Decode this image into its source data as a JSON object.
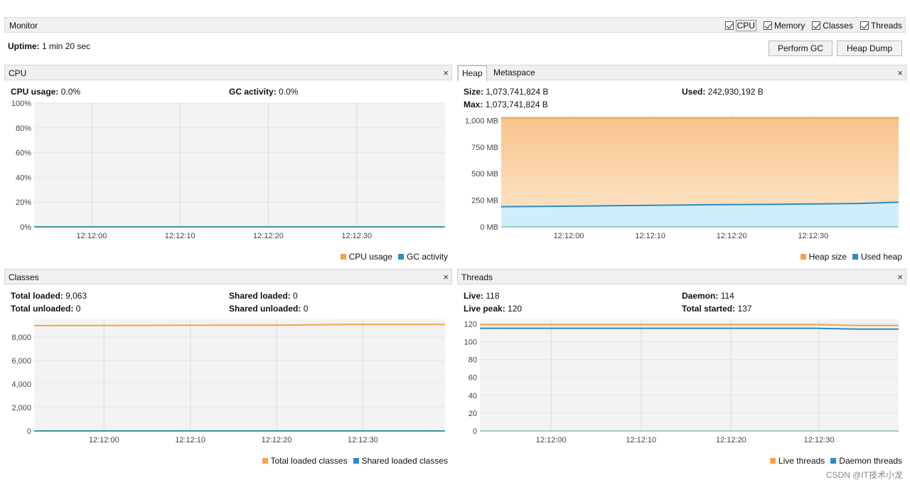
{
  "monitor": {
    "title": "Monitor",
    "checks": [
      {
        "label": "CPU"
      },
      {
        "label": "Memory"
      },
      {
        "label": "Classes"
      },
      {
        "label": "Threads"
      }
    ]
  },
  "uptime": {
    "label": "Uptime:",
    "value": "1 min 20 sec"
  },
  "buttons": {
    "perform_gc": "Perform GC",
    "heap_dump": "Heap Dump"
  },
  "cpu": {
    "title": "CPU",
    "close": "×",
    "usage_label": "CPU usage:",
    "usage_value": "0.0%",
    "gc_label": "GC activity:",
    "gc_value": "0.0%",
    "legend": [
      {
        "name": "CPU usage",
        "color": "#f0a54a"
      },
      {
        "name": "GC activity",
        "color": "#2e8bc0"
      }
    ]
  },
  "heap": {
    "tabs": [
      "Heap",
      "Metaspace"
    ],
    "close": "×",
    "size_label": "Size:",
    "size_value": "1,073,741,824 B",
    "used_label": "Used:",
    "used_value": "242,930,192 B",
    "max_label": "Max:",
    "max_value": "1,073,741,824 B",
    "legend": [
      {
        "name": "Heap size",
        "color": "#f0a54a"
      },
      {
        "name": "Used heap",
        "color": "#2e8bc0"
      }
    ]
  },
  "classes": {
    "title": "Classes",
    "close": "×",
    "total_loaded_label": "Total loaded:",
    "total_loaded_value": "9,063",
    "total_unloaded_label": "Total unloaded:",
    "total_unloaded_value": "0",
    "shared_loaded_label": "Shared loaded:",
    "shared_loaded_value": "0",
    "shared_unloaded_label": "Shared unloaded:",
    "shared_unloaded_value": "0",
    "legend": [
      {
        "name": "Total loaded classes",
        "color": "#f0a54a"
      },
      {
        "name": "Shared loaded classes",
        "color": "#2e8bc0"
      }
    ]
  },
  "threads": {
    "title": "Threads",
    "close": "×",
    "live_label": "Live:",
    "live_value": "118",
    "daemon_label": "Daemon:",
    "daemon_value": "114",
    "peak_label": "Live peak:",
    "peak_value": "120",
    "started_label": "Total started:",
    "started_value": "137",
    "legend": [
      {
        "name": "Live threads",
        "color": "#f0a54a"
      },
      {
        "name": "Daemon threads",
        "color": "#2e8bc0"
      }
    ]
  },
  "watermark": "CSDN @IT技术小龙",
  "chart_data": [
    {
      "id": "cpu",
      "type": "line",
      "x_ticks": [
        "12:12:00",
        "12:12:10",
        "12:12:20",
        "12:12:30"
      ],
      "y_ticks": [
        "0%",
        "20%",
        "40%",
        "60%",
        "80%",
        "100%"
      ],
      "ylim": [
        0,
        100
      ],
      "series": [
        {
          "name": "CPU usage",
          "color": "#f0a54a",
          "values": [
            0,
            0,
            0,
            0,
            0,
            0,
            0,
            0,
            0
          ]
        },
        {
          "name": "GC activity",
          "color": "#2e8bc0",
          "values": [
            0,
            0,
            0,
            0,
            0,
            0,
            0,
            0,
            0
          ]
        }
      ]
    },
    {
      "id": "heap",
      "type": "area",
      "x_ticks": [
        "12:12:00",
        "12:12:10",
        "12:12:20",
        "12:12:30"
      ],
      "y_ticks": [
        "0 MB",
        "250 MB",
        "500 MB",
        "750 MB",
        "1,000 MB"
      ],
      "ylim": [
        0,
        1050
      ],
      "series": [
        {
          "name": "Heap size",
          "color": "#f0a54a",
          "values": [
            1024,
            1024,
            1024,
            1024,
            1024,
            1024,
            1024,
            1024,
            1024,
            1024,
            1024
          ]
        },
        {
          "name": "Used heap",
          "color": "#2e8bc0",
          "values": [
            190,
            192,
            195,
            200,
            203,
            207,
            210,
            213,
            216,
            220,
            232
          ]
        }
      ]
    },
    {
      "id": "classes",
      "type": "line",
      "x_ticks": [
        "12:12:00",
        "12:12:10",
        "12:12:20",
        "12:12:30"
      ],
      "y_ticks": [
        "0",
        "2,000",
        "4,000",
        "6,000",
        "8,000"
      ],
      "ylim": [
        0,
        9500
      ],
      "series": [
        {
          "name": "Total loaded classes",
          "color": "#f0a54a",
          "values": [
            8960,
            8970,
            8980,
            8990,
            9000,
            9010,
            9063,
            9063,
            9063
          ]
        },
        {
          "name": "Shared loaded classes",
          "color": "#2e8bc0",
          "values": [
            0,
            0,
            0,
            0,
            0,
            0,
            0,
            0,
            0
          ]
        }
      ]
    },
    {
      "id": "threads",
      "type": "line",
      "x_ticks": [
        "12:12:00",
        "12:12:10",
        "12:12:20",
        "12:12:30"
      ],
      "y_ticks": [
        "0",
        "20",
        "40",
        "60",
        "80",
        "100",
        "120"
      ],
      "ylim": [
        0,
        125
      ],
      "series": [
        {
          "name": "Live threads",
          "color": "#f0a54a",
          "values": [
            119,
            119,
            119,
            119,
            119,
            119,
            119,
            119,
            119,
            118,
            118
          ]
        },
        {
          "name": "Daemon threads",
          "color": "#2e8bc0",
          "values": [
            115,
            115,
            115,
            115,
            115,
            115,
            115,
            115,
            115,
            114,
            114
          ]
        }
      ]
    }
  ]
}
